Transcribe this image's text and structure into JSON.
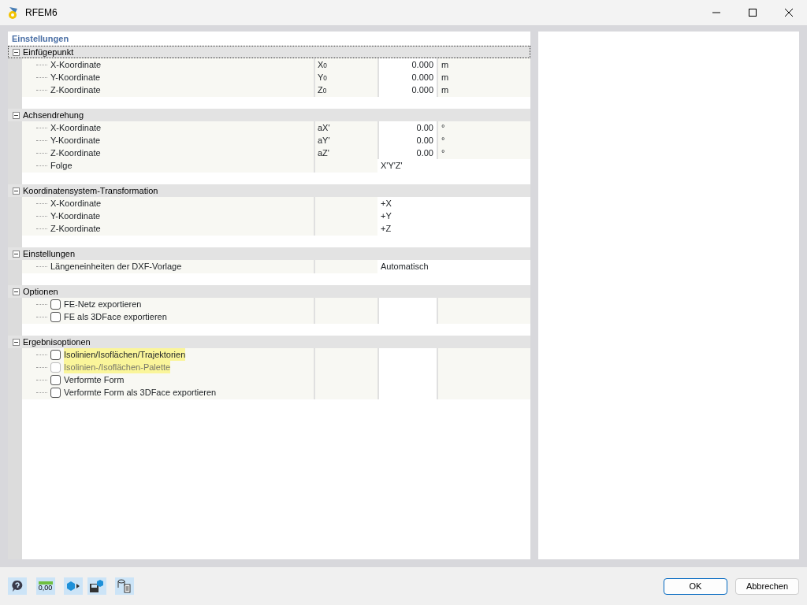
{
  "window": {
    "title": "RFEM6"
  },
  "panel_title": "Einstellungen",
  "groups": [
    {
      "label": "Einfügepunkt",
      "expanded": true,
      "focused": true,
      "items": [
        {
          "kind": "value",
          "label": "X-Koordinate",
          "symbol": "X$_{0}$",
          "value": "0.000",
          "unit": "m"
        },
        {
          "kind": "value",
          "label": "Y-Koordinate",
          "symbol": "Y$_{0}$",
          "value": "0.000",
          "unit": "m"
        },
        {
          "kind": "value",
          "label": "Z-Koordinate",
          "symbol": "Z$_{0}$",
          "value": "0.000",
          "unit": "m"
        }
      ]
    },
    {
      "label": "Achsendrehung",
      "expanded": true,
      "focused": false,
      "items": [
        {
          "kind": "value",
          "label": "X-Koordinate",
          "symbol": "aX'",
          "value": "0.00",
          "unit": "°"
        },
        {
          "kind": "value",
          "label": "Y-Koordinate",
          "symbol": "aY'",
          "value": "0.00",
          "unit": "°"
        },
        {
          "kind": "value",
          "label": "Z-Koordinate",
          "symbol": "aZ'",
          "value": "0.00",
          "unit": "°"
        },
        {
          "kind": "text",
          "label": "Folge",
          "value": "X'Y'Z'"
        }
      ]
    },
    {
      "label": "Koordinatensystem-Transformation",
      "expanded": true,
      "focused": false,
      "items": [
        {
          "kind": "text",
          "label": "X-Koordinate",
          "value": "+X"
        },
        {
          "kind": "text",
          "label": "Y-Koordinate",
          "value": "+Y"
        },
        {
          "kind": "text",
          "label": "Z-Koordinate",
          "value": "+Z"
        }
      ]
    },
    {
      "label": "Einstellungen",
      "expanded": true,
      "focused": false,
      "items": [
        {
          "kind": "text",
          "label": "Längeneinheiten der DXF-Vorlage",
          "value": "Automatisch"
        }
      ]
    },
    {
      "label": "Optionen",
      "expanded": true,
      "focused": false,
      "items": [
        {
          "kind": "check",
          "label": "FE-Netz exportieren",
          "checked": false,
          "disabled": false,
          "highlighted": false
        },
        {
          "kind": "check",
          "label": "FE als 3DFace exportieren",
          "checked": false,
          "disabled": false,
          "highlighted": false
        }
      ]
    },
    {
      "label": "Ergebnisoptionen",
      "expanded": true,
      "focused": false,
      "items": [
        {
          "kind": "check",
          "label": "Isolinien/Isoflächen/Trajektorien",
          "checked": false,
          "disabled": false,
          "highlighted": true
        },
        {
          "kind": "check",
          "label": "Isolinien-/Isoflächen-Palette",
          "checked": false,
          "disabled": true,
          "highlighted": true
        },
        {
          "kind": "check",
          "label": "Verformte Form",
          "checked": false,
          "disabled": false,
          "highlighted": false
        },
        {
          "kind": "check",
          "label": "Verformte Form als 3DFace exportieren",
          "checked": false,
          "disabled": false,
          "highlighted": false
        }
      ]
    }
  ],
  "toolbar": [
    {
      "kind": "help"
    },
    {
      "kind": "decimals",
      "text": "0,00"
    },
    {
      "kind": "export"
    },
    {
      "kind": "save"
    },
    {
      "kind": "report"
    }
  ],
  "buttons": [
    {
      "label": "OK",
      "default": true
    },
    {
      "label": "Abbrechen",
      "default": false
    }
  ]
}
